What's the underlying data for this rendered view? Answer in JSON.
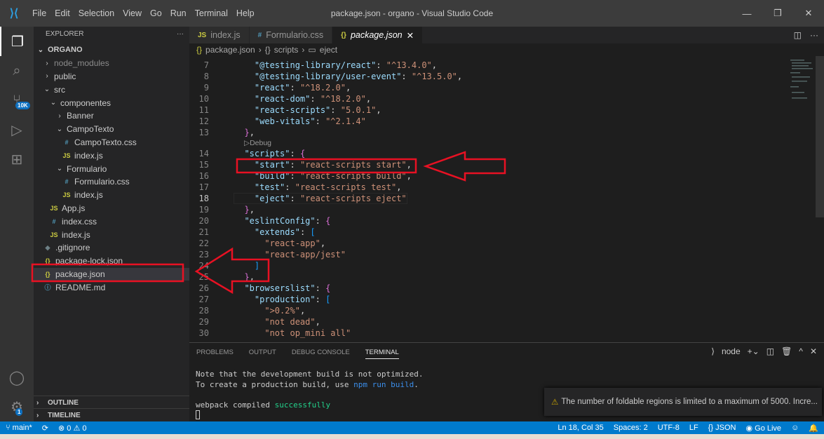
{
  "window": {
    "title": "package.json - organo - Visual Studio Code",
    "menu": [
      "File",
      "Edit",
      "Selection",
      "View",
      "Go",
      "Run",
      "Terminal",
      "Help"
    ],
    "controls": [
      "—",
      "❐",
      "✕"
    ]
  },
  "activity": {
    "items": [
      "explorer-icon",
      "search-icon",
      "source-control-icon",
      "run-debug-icon",
      "extensions-icon"
    ],
    "scm_badge": "10K",
    "settings_badge": "1"
  },
  "sidebar": {
    "title": "EXPLORER",
    "more": "···",
    "root": "ORGANO",
    "items": [
      {
        "label": "node_modules",
        "type": "folder",
        "open": false,
        "depth": 1,
        "dim": true
      },
      {
        "label": "public",
        "type": "folder",
        "open": false,
        "depth": 1
      },
      {
        "label": "src",
        "type": "folder",
        "open": true,
        "depth": 1
      },
      {
        "label": "componentes",
        "type": "folder",
        "open": true,
        "depth": 2
      },
      {
        "label": "Banner",
        "type": "folder",
        "open": false,
        "depth": 3
      },
      {
        "label": "CampoTexto",
        "type": "folder",
        "open": true,
        "depth": 3
      },
      {
        "label": "CampoTexto.css",
        "type": "css",
        "depth": 4
      },
      {
        "label": "index.js",
        "type": "js",
        "depth": 4
      },
      {
        "label": "Formulario",
        "type": "folder",
        "open": true,
        "depth": 3
      },
      {
        "label": "Formulario.css",
        "type": "css",
        "depth": 4
      },
      {
        "label": "index.js",
        "type": "js",
        "depth": 4
      },
      {
        "label": "App.js",
        "type": "js",
        "depth": 2
      },
      {
        "label": "index.css",
        "type": "css",
        "depth": 2
      },
      {
        "label": "index.js",
        "type": "js",
        "depth": 2
      },
      {
        "label": ".gitignore",
        "type": "git",
        "depth": 1
      },
      {
        "label": "package-lock.json",
        "type": "json",
        "depth": 1
      },
      {
        "label": "package.json",
        "type": "json",
        "depth": 1,
        "selected": true
      },
      {
        "label": "README.md",
        "type": "md",
        "depth": 1
      }
    ],
    "outline": "OUTLINE",
    "timeline": "TIMELINE"
  },
  "tabs": [
    {
      "label": "index.js",
      "icon": "JS"
    },
    {
      "label": "Formulario.css",
      "icon": "#"
    },
    {
      "label": "package.json",
      "icon": "{}",
      "active": true
    }
  ],
  "breadcrumb": [
    "package.json",
    "scripts",
    "eject"
  ],
  "codelens": "Debug",
  "code": [
    {
      "n": "7",
      "t": [
        [
          "    ",
          "p"
        ],
        [
          "\"@testing-library/react\"",
          "k"
        ],
        [
          ": ",
          "p"
        ],
        [
          "\"^13.4.0\"",
          "s"
        ],
        [
          ",",
          "p"
        ]
      ]
    },
    {
      "n": "8",
      "t": [
        [
          "    ",
          "p"
        ],
        [
          "\"@testing-library/user-event\"",
          "k"
        ],
        [
          ": ",
          "p"
        ],
        [
          "\"^13.5.0\"",
          "s"
        ],
        [
          ",",
          "p"
        ]
      ]
    },
    {
      "n": "9",
      "t": [
        [
          "    ",
          "p"
        ],
        [
          "\"react\"",
          "k"
        ],
        [
          ": ",
          "p"
        ],
        [
          "\"^18.2.0\"",
          "s"
        ],
        [
          ",",
          "p"
        ]
      ]
    },
    {
      "n": "10",
      "t": [
        [
          "    ",
          "p"
        ],
        [
          "\"react-dom\"",
          "k"
        ],
        [
          ": ",
          "p"
        ],
        [
          "\"^18.2.0\"",
          "s"
        ],
        [
          ",",
          "p"
        ]
      ]
    },
    {
      "n": "11",
      "t": [
        [
          "    ",
          "p"
        ],
        [
          "\"react-scripts\"",
          "k"
        ],
        [
          ": ",
          "p"
        ],
        [
          "\"5.0.1\"",
          "s"
        ],
        [
          ",",
          "p"
        ]
      ]
    },
    {
      "n": "12",
      "t": [
        [
          "    ",
          "p"
        ],
        [
          "\"web-vitals\"",
          "k"
        ],
        [
          ": ",
          "p"
        ],
        [
          "\"^2.1.4\"",
          "s"
        ]
      ]
    },
    {
      "n": "13",
      "t": [
        [
          "  ",
          "p"
        ],
        [
          "}",
          "b2"
        ],
        [
          ",",
          "p"
        ]
      ],
      "lens": true
    },
    {
      "n": "14",
      "t": [
        [
          "  ",
          "p"
        ],
        [
          "\"scripts\"",
          "k"
        ],
        [
          ": ",
          "p"
        ],
        [
          "{",
          "b2"
        ]
      ]
    },
    {
      "n": "15",
      "t": [
        [
          "    ",
          "p"
        ],
        [
          "\"start\"",
          "k"
        ],
        [
          ": ",
          "p"
        ],
        [
          "\"react-scripts start\"",
          "s"
        ],
        [
          ",",
          "p"
        ]
      ]
    },
    {
      "n": "16",
      "t": [
        [
          "    ",
          "p"
        ],
        [
          "\"build\"",
          "k"
        ],
        [
          ": ",
          "p"
        ],
        [
          "\"react-scripts build\"",
          "s"
        ],
        [
          ",",
          "p"
        ]
      ]
    },
    {
      "n": "17",
      "t": [
        [
          "    ",
          "p"
        ],
        [
          "\"test\"",
          "k"
        ],
        [
          ": ",
          "p"
        ],
        [
          "\"react-scripts test\"",
          "s"
        ],
        [
          ",",
          "p"
        ]
      ]
    },
    {
      "n": "18",
      "t": [
        [
          "    ",
          "p"
        ],
        [
          "\"eject\"",
          "k"
        ],
        [
          ": ",
          "p"
        ],
        [
          "\"react-scripts eject\"",
          "s"
        ]
      ],
      "current": true
    },
    {
      "n": "19",
      "t": [
        [
          "  ",
          "p"
        ],
        [
          "}",
          "b2"
        ],
        [
          ",",
          "p"
        ]
      ]
    },
    {
      "n": "20",
      "t": [
        [
          "  ",
          "p"
        ],
        [
          "\"eslintConfig\"",
          "k"
        ],
        [
          ": ",
          "p"
        ],
        [
          "{",
          "b2"
        ]
      ]
    },
    {
      "n": "21",
      "t": [
        [
          "    ",
          "p"
        ],
        [
          "\"extends\"",
          "k"
        ],
        [
          ": ",
          "p"
        ],
        [
          "[",
          "b3"
        ]
      ]
    },
    {
      "n": "22",
      "t": [
        [
          "      ",
          "p"
        ],
        [
          "\"react-app\"",
          "s"
        ],
        [
          ",",
          "p"
        ]
      ]
    },
    {
      "n": "23",
      "t": [
        [
          "      ",
          "p"
        ],
        [
          "\"react-app/jest\"",
          "s"
        ]
      ]
    },
    {
      "n": "24",
      "t": [
        [
          "    ",
          "p"
        ],
        [
          "]",
          "b3"
        ]
      ]
    },
    {
      "n": "25",
      "t": [
        [
          "  ",
          "p"
        ],
        [
          "}",
          "b2"
        ],
        [
          ",",
          "p"
        ]
      ]
    },
    {
      "n": "26",
      "t": [
        [
          "  ",
          "p"
        ],
        [
          "\"browserslist\"",
          "k"
        ],
        [
          ": ",
          "p"
        ],
        [
          "{",
          "b2"
        ]
      ]
    },
    {
      "n": "27",
      "t": [
        [
          "    ",
          "p"
        ],
        [
          "\"production\"",
          "k"
        ],
        [
          ": ",
          "p"
        ],
        [
          "[",
          "b3"
        ]
      ]
    },
    {
      "n": "28",
      "t": [
        [
          "      ",
          "p"
        ],
        [
          "\">0.2%\"",
          "s"
        ],
        [
          ",",
          "p"
        ]
      ]
    },
    {
      "n": "29",
      "t": [
        [
          "      ",
          "p"
        ],
        [
          "\"not dead\"",
          "s"
        ],
        [
          ",",
          "p"
        ]
      ]
    },
    {
      "n": "30",
      "t": [
        [
          "      ",
          "p"
        ],
        [
          "\"not op_mini all\"",
          "s"
        ]
      ]
    }
  ],
  "panel": {
    "tabs": [
      "PROBLEMS",
      "OUTPUT",
      "DEBUG CONSOLE",
      "TERMINAL"
    ],
    "active_tab": "TERMINAL",
    "shell": "node",
    "terminal": {
      "line1": "Note that the development build is not optimized.",
      "line2_pre": "To create a production build, use ",
      "line2_cmd": "npm run build",
      "line2_post": ".",
      "line3_pre": "webpack compiled ",
      "line3_ok": "successfully"
    }
  },
  "notification": {
    "text": "The number of foldable regions is limited to a maximum of 5000. Incre..."
  },
  "status": {
    "branch": "main*",
    "errors": "0",
    "warnings": "0",
    "position": "Ln 18, Col 35",
    "spaces": "Spaces: 2",
    "encoding": "UTF-8",
    "eol": "LF",
    "language": "JSON",
    "golive": "Go Live"
  },
  "colors": {
    "accent": "#007acc",
    "annotation": "#e81123"
  }
}
